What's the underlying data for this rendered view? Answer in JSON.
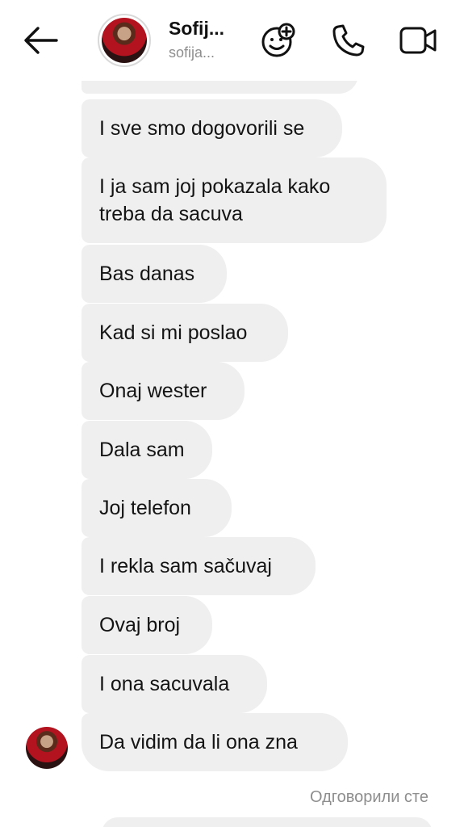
{
  "header": {
    "contact_name": "Sofij...",
    "contact_username": "sofija...",
    "icons": [
      "arrow-left-icon",
      "sparkle-face-icon",
      "phone-icon",
      "video-camera-icon"
    ]
  },
  "messages": [
    {
      "text": "I sve smo dogovorili se"
    },
    {
      "text": "I ja sam joj pokazala kako treba da sacuva"
    },
    {
      "text": "Bas danas"
    },
    {
      "text": "Kad si mi poslao"
    },
    {
      "text": "Onaj wester"
    },
    {
      "text": "Dala sam"
    },
    {
      "text": "Joj telefon"
    },
    {
      "text": "I rekla sam sačuvaj"
    },
    {
      "text": "Ovaj broj"
    },
    {
      "text": "I ona sacuvala"
    },
    {
      "text": "Da vidim da li ona zna"
    }
  ],
  "reply_status": "Одговорили сте",
  "colors": {
    "bubble": "#efefef",
    "text": "#141414",
    "muted": "#8e8e8e"
  }
}
